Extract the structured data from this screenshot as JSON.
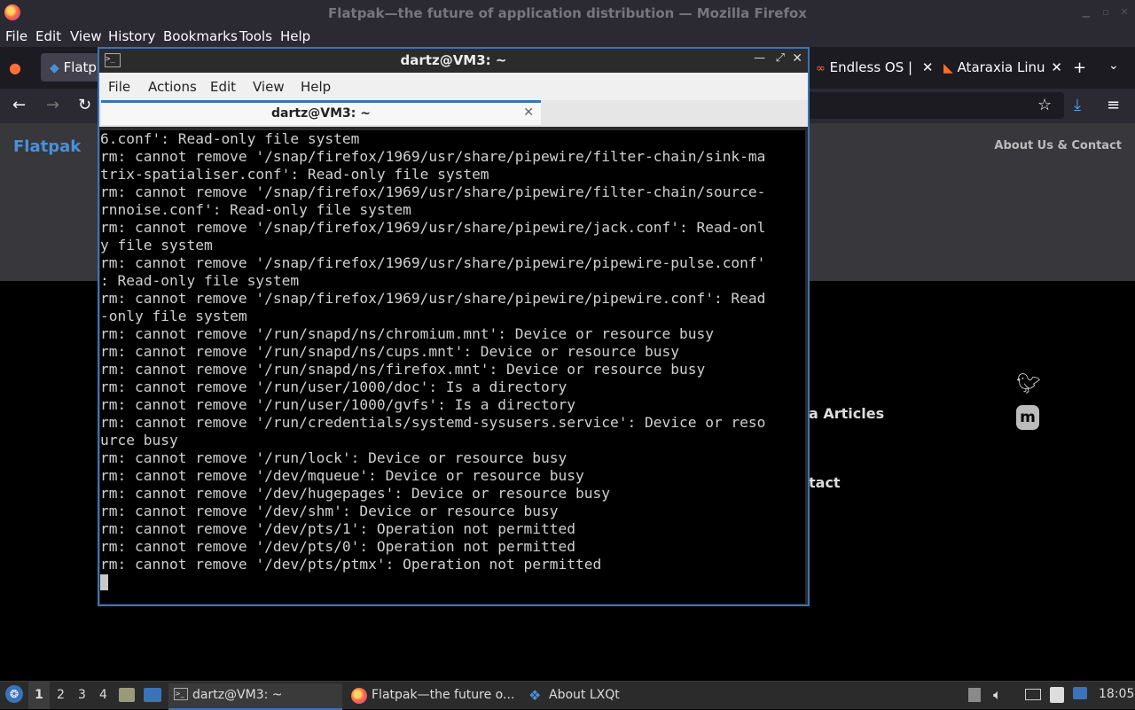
{
  "firefox": {
    "title": "Flatpak—the future of application distribution — Mozilla Firefox",
    "menu": [
      "File",
      "Edit",
      "View",
      "History",
      "Bookmarks",
      "Tools",
      "Help"
    ],
    "tabs": [
      {
        "label": "Flatp"
      },
      {
        "label": "Endless OS |"
      },
      {
        "label": "Ataraxia Linu"
      }
    ],
    "page": {
      "brand": "Flatpak",
      "about_link": "About Us & Contact",
      "footer_links": [
        "a Articles",
        "tact"
      ]
    }
  },
  "terminal": {
    "title": "dartz@VM3: ~",
    "menu": [
      "File",
      "Actions",
      "Edit",
      "View",
      "Help"
    ],
    "tab_label": "dartz@VM3: ~",
    "lines": [
      "6.conf': Read-only file system",
      "rm: cannot remove '/snap/firefox/1969/usr/share/pipewire/filter-chain/sink-ma",
      "trix-spatialiser.conf': Read-only file system",
      "rm: cannot remove '/snap/firefox/1969/usr/share/pipewire/filter-chain/source-",
      "rnnoise.conf': Read-only file system",
      "rm: cannot remove '/snap/firefox/1969/usr/share/pipewire/jack.conf': Read-onl",
      "y file system",
      "rm: cannot remove '/snap/firefox/1969/usr/share/pipewire/pipewire-pulse.conf'",
      ": Read-only file system",
      "rm: cannot remove '/snap/firefox/1969/usr/share/pipewire/pipewire.conf': Read",
      "-only file system",
      "rm: cannot remove '/run/snapd/ns/chromium.mnt': Device or resource busy",
      "rm: cannot remove '/run/snapd/ns/cups.mnt': Device or resource busy",
      "rm: cannot remove '/run/snapd/ns/firefox.mnt': Device or resource busy",
      "rm: cannot remove '/run/user/1000/doc': Is a directory",
      "rm: cannot remove '/run/user/1000/gvfs': Is a directory",
      "rm: cannot remove '/run/credentials/systemd-sysusers.service': Device or reso",
      "urce busy",
      "rm: cannot remove '/run/lock': Device or resource busy",
      "rm: cannot remove '/dev/mqueue': Device or resource busy",
      "rm: cannot remove '/dev/hugepages': Device or resource busy",
      "rm: cannot remove '/dev/shm': Device or resource busy",
      "rm: cannot remove '/dev/pts/1': Operation not permitted",
      "rm: cannot remove '/dev/pts/0': Operation not permitted",
      "rm: cannot remove '/dev/pts/ptmx': Operation not permitted"
    ]
  },
  "taskbar": {
    "workspaces": [
      "1",
      "2",
      "3",
      "4"
    ],
    "tasks": [
      {
        "label": "dartz@VM3: ~"
      },
      {
        "label": "Flatpak—the future o..."
      },
      {
        "label": "About LXQt"
      }
    ],
    "clock": "18:05"
  },
  "colors": {
    "accent": "#3a73b8",
    "brand": "#4a90d9"
  }
}
